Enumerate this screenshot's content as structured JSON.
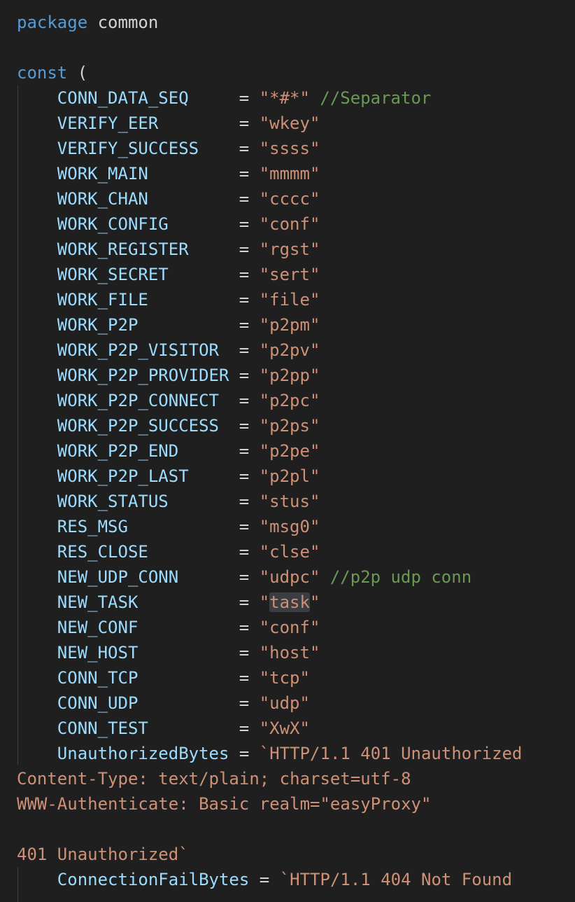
{
  "code": {
    "package_kw": "package",
    "package_name": "common",
    "const_kw": "const",
    "open_paren": "(",
    "constants": [
      {
        "name": "CONN_DATA_SEQ",
        "value": "\"*#*\"",
        "comment": "//Separator"
      },
      {
        "name": "VERIFY_EER",
        "value": "\"wkey\"",
        "comment": ""
      },
      {
        "name": "VERIFY_SUCCESS",
        "value": "\"ssss\"",
        "comment": ""
      },
      {
        "name": "WORK_MAIN",
        "value": "\"mmmm\"",
        "comment": ""
      },
      {
        "name": "WORK_CHAN",
        "value": "\"cccc\"",
        "comment": ""
      },
      {
        "name": "WORK_CONFIG",
        "value": "\"conf\"",
        "comment": ""
      },
      {
        "name": "WORK_REGISTER",
        "value": "\"rgst\"",
        "comment": ""
      },
      {
        "name": "WORK_SECRET",
        "value": "\"sert\"",
        "comment": ""
      },
      {
        "name": "WORK_FILE",
        "value": "\"file\"",
        "comment": ""
      },
      {
        "name": "WORK_P2P",
        "value": "\"p2pm\"",
        "comment": ""
      },
      {
        "name": "WORK_P2P_VISITOR",
        "value": "\"p2pv\"",
        "comment": ""
      },
      {
        "name": "WORK_P2P_PROVIDER",
        "value": "\"p2pp\"",
        "comment": ""
      },
      {
        "name": "WORK_P2P_CONNECT",
        "value": "\"p2pc\"",
        "comment": ""
      },
      {
        "name": "WORK_P2P_SUCCESS",
        "value": "\"p2ps\"",
        "comment": ""
      },
      {
        "name": "WORK_P2P_END",
        "value": "\"p2pe\"",
        "comment": ""
      },
      {
        "name": "WORK_P2P_LAST",
        "value": "\"p2pl\"",
        "comment": ""
      },
      {
        "name": "WORK_STATUS",
        "value": "\"stus\"",
        "comment": ""
      },
      {
        "name": "RES_MSG",
        "value": "\"msg0\"",
        "comment": ""
      },
      {
        "name": "RES_CLOSE",
        "value": "\"clse\"",
        "comment": ""
      },
      {
        "name": "NEW_UDP_CONN",
        "value": "\"udpc\"",
        "comment": "//p2p udp conn"
      },
      {
        "name": "NEW_TASK",
        "value_open": "\"",
        "value_hl": "task",
        "value_close": "\"",
        "comment": ""
      },
      {
        "name": "NEW_CONF",
        "value": "\"conf\"",
        "comment": ""
      },
      {
        "name": "NEW_HOST",
        "value": "\"host\"",
        "comment": ""
      },
      {
        "name": "CONN_TCP",
        "value": "\"tcp\"",
        "comment": ""
      },
      {
        "name": "CONN_UDP",
        "value": "\"udp\"",
        "comment": ""
      },
      {
        "name": "CONN_TEST",
        "value": "\"XwX\"",
        "comment": ""
      }
    ],
    "unauthorized_name": "UnauthorizedBytes",
    "unauthorized_line1": "`HTTP/1.1 401 Unauthorized",
    "unauthorized_line2": "Content-Type: text/plain; charset=utf-8",
    "unauthorized_line3": "WWW-Authenticate: Basic realm=\"easyProxy\"",
    "unauthorized_line4": "",
    "unauthorized_line5": "401 Unauthorized`",
    "connfail_name": "ConnectionFailBytes",
    "connfail_line1": "`HTTP/1.1 404 Not Found",
    "equals": "="
  },
  "colors": {
    "background": "#1f1f1f",
    "keyword": "#569cd6",
    "constant": "#9cdcfe",
    "string": "#ce9178",
    "comment": "#6a9955"
  }
}
